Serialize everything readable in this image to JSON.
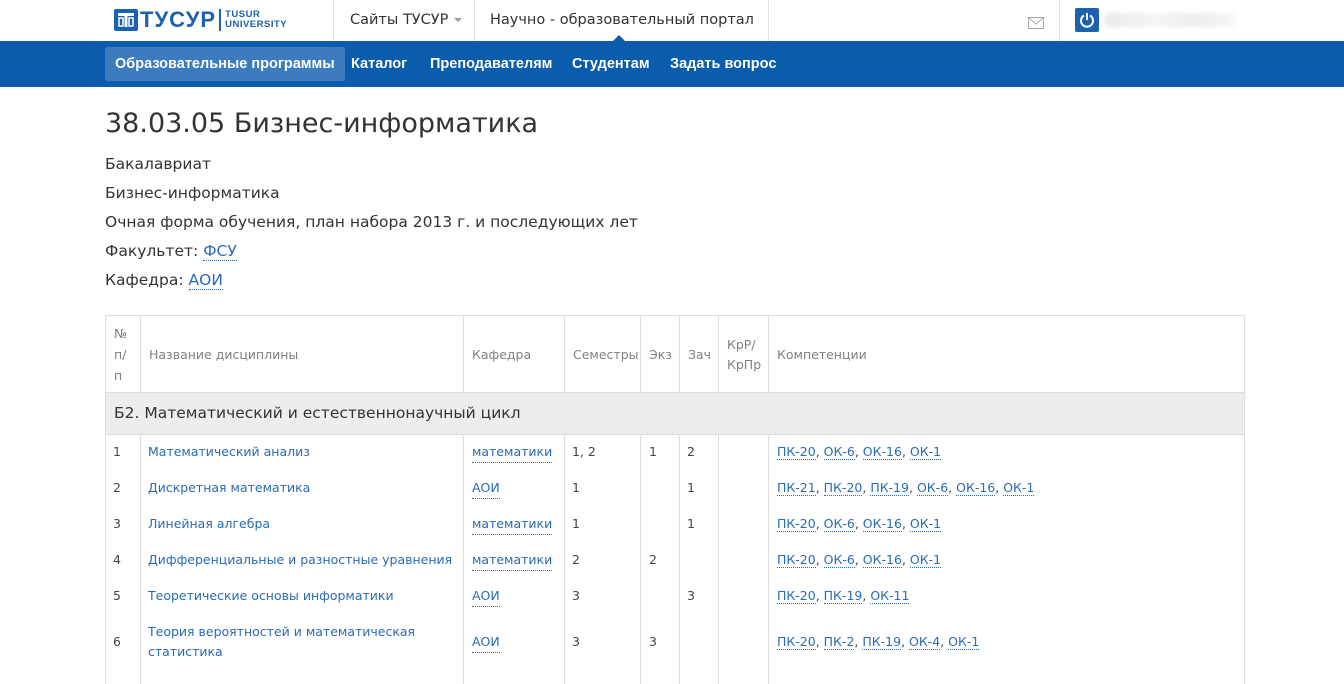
{
  "brand": {
    "logo_text": "ТУСУР",
    "logo_sub_line1": "TUSUR",
    "logo_sub_line2": "UNIVERSITY",
    "brand_color": "#1c61ad"
  },
  "topbar": {
    "sites_label": "Сайты ТУСУР",
    "portal_label": "Научно - образовательный портал",
    "mail_icon": "mail-icon",
    "power_icon": "power-icon"
  },
  "nav": {
    "items": [
      {
        "label": "Образовательные программы",
        "active": true
      },
      {
        "label": "Каталог",
        "active": false
      },
      {
        "label": "Преподавателям",
        "active": false
      },
      {
        "label": "Студентам",
        "active": false
      },
      {
        "label": "Задать вопрос",
        "active": false
      }
    ],
    "bar_color": "#0b5cad",
    "active_color": "#3b7bbe"
  },
  "program": {
    "title": "38.03.05 Бизнес-информатика",
    "level": "Бакалавриат",
    "profile": "Бизнес-информатика",
    "form": "Очная форма обучения, план набора 2013 г. и последующих лет",
    "faculty_label": "Факультет:",
    "faculty_value": "ФСУ",
    "department_label": "Кафедра:",
    "department_value": "АОИ"
  },
  "table": {
    "headers": {
      "num_1": "№",
      "num_2": "п/",
      "num_3": "п",
      "name": "Название дисциплины",
      "dept": "Кафедра",
      "semesters": "Семестры",
      "exam": "Экз",
      "credit": "Зач",
      "kr_1": "КрР/",
      "kr_2": "КрПр",
      "competencies": "Компетенции"
    },
    "section_title": "Б2. Математический и естественнонаучный цикл",
    "rows": [
      {
        "num": "1",
        "name_1": "Математический анализ",
        "name_2": "",
        "dept": "математики",
        "sem": "1, 2",
        "exam": "1",
        "credit": "2",
        "kr": "",
        "comps": [
          "ПК-20",
          "ОК-6",
          "ОК-16",
          "ОК-1"
        ]
      },
      {
        "num": "2",
        "name_1": "Дискретная математика",
        "name_2": "",
        "dept": "АОИ",
        "sem": "1",
        "exam": "",
        "credit": "1",
        "kr": "",
        "comps": [
          "ПК-21",
          "ПК-20",
          "ПК-19",
          "ОК-6",
          "ОК-16",
          "ОК-1"
        ]
      },
      {
        "num": "3",
        "name_1": "Линейная алгебра",
        "name_2": "",
        "dept": "математики",
        "sem": "1",
        "exam": "",
        "credit": "1",
        "kr": "",
        "comps": [
          "ПК-20",
          "ОК-6",
          "ОК-16",
          "ОК-1"
        ]
      },
      {
        "num": "4",
        "name_1": "Дифференциальные и разностные уравнения",
        "name_2": "",
        "dept": "математики",
        "sem": "2",
        "exam": "2",
        "credit": "",
        "kr": "",
        "comps": [
          "ПК-20",
          "ОК-6",
          "ОК-16",
          "ОК-1"
        ]
      },
      {
        "num": "5",
        "name_1": "Теоретические основы информатики",
        "name_2": "",
        "dept": "АОИ",
        "sem": "3",
        "exam": "",
        "credit": "3",
        "kr": "",
        "comps": [
          "ПК-20",
          "ПК-19",
          "ОК-11"
        ]
      },
      {
        "num": "6",
        "name_1": "Теория вероятностей и математическая",
        "name_2": "статистика",
        "dept": "АОИ",
        "sem": "3",
        "exam": "3",
        "credit": "",
        "kr": "",
        "comps": [
          "ПК-20",
          "ПК-2",
          "ПК-19",
          "ОК-4",
          "ОК-1"
        ]
      }
    ]
  }
}
